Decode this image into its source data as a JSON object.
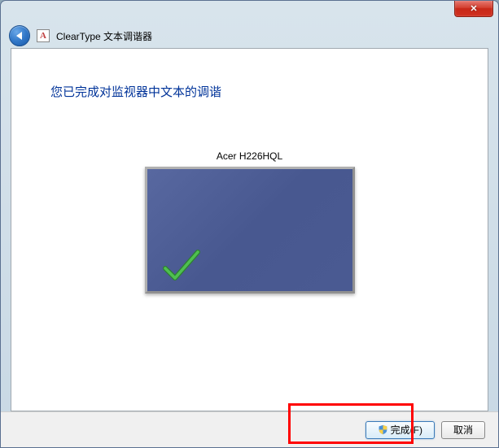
{
  "window": {
    "title": "ClearType 文本调谐器",
    "app_icon_letter": "A"
  },
  "content": {
    "heading": "您已完成对监视器中文本的调谐",
    "monitor_name": "Acer H226HQL"
  },
  "buttons": {
    "finish_label": "完成(F)",
    "cancel_label": "取消"
  }
}
